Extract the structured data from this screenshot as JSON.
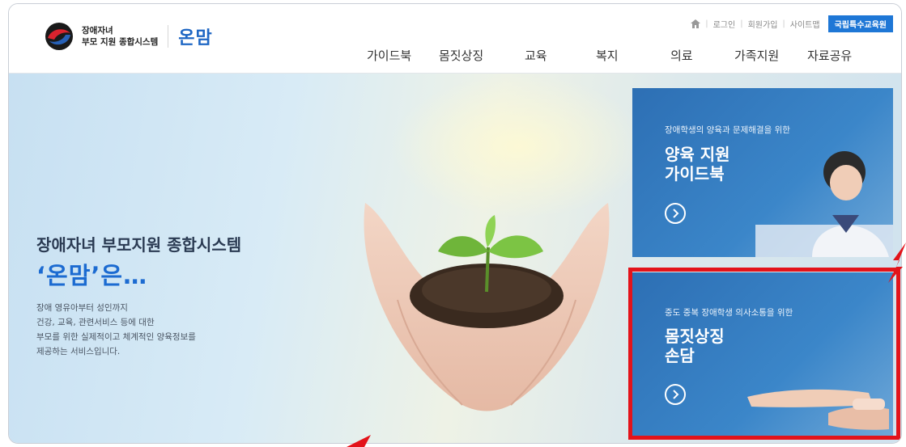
{
  "header": {
    "logo_line1": "장애자녀",
    "logo_line2": "부모 지원 종합시스템",
    "brand": "온맘",
    "util_links": [
      "로그인",
      "회원가입",
      "사이트맵"
    ],
    "util_button": "국립특수교육원"
  },
  "gnb": [
    "가이드북",
    "몸짓상징",
    "교육",
    "복지",
    "의료",
    "가족지원",
    "자료공유"
  ],
  "hero": {
    "title": "장애자녀 부모지원 종합시스템",
    "big": "‘온맘’은…",
    "desc": [
      "장애 영유아부터 성인까지",
      "건강, 교육, 관련서비스 등에 대한",
      "부모를 위한 실제적이고 체계적인 양육정보를",
      "제공하는 서비스입니다."
    ]
  },
  "cards": [
    {
      "sub": "장애학생의 양육과 문제해결을 위한",
      "title_line1": "양육 지원",
      "title_line2": "가이드북"
    },
    {
      "sub": "중도 중복 장애학생 의사소통을 위한",
      "title_line1": "몸짓상징",
      "title_line2": "손담"
    }
  ],
  "colors": {
    "brand_blue": "#1f67c4",
    "card_blue": "#2d6fb4",
    "highlight_red": "#e3131a",
    "util_button": "#1e77d6"
  },
  "icons": [
    "logo-mark-icon",
    "home-icon",
    "arrow-circle-icon"
  ]
}
